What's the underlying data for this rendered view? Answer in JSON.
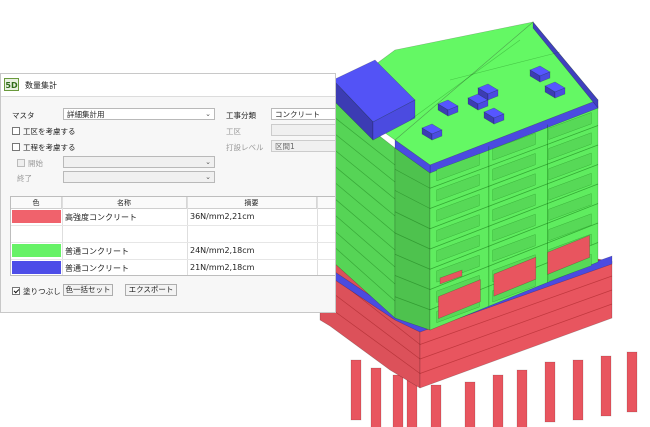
{
  "window": {
    "title": "数量集計",
    "logo": "5D"
  },
  "form": {
    "master_label": "マスタ",
    "master_value": "詳細集計用",
    "work_label": "工事分類",
    "work_value": "コンクリート",
    "consider_zone_label": "工区を考慮する",
    "zone_label": "工区",
    "zone_value": "",
    "consider_process_label": "工程を考慮する",
    "pour_level_label": "打設レベル",
    "pour_level_value": "区間1",
    "start_label": "開始",
    "start_value": "",
    "end_label": "終了",
    "end_value": ""
  },
  "table": {
    "headers": [
      "色",
      "名称",
      "摘要"
    ],
    "rows": [
      {
        "color": "#f0626c",
        "name": "高強度コンクリート",
        "spec": "36N/mm2,21cm"
      },
      {
        "color": "#ffffff",
        "name": "",
        "spec": ""
      },
      {
        "color": "#66f266",
        "name": "普通コンクリート",
        "spec": "24N/mm2,18cm"
      },
      {
        "color": "#4d4de8",
        "name": "普通コンクリート",
        "spec": "21N/mm2,18cm"
      }
    ]
  },
  "bottom": {
    "fill_label": "塗りつぶし",
    "fill_checked": true,
    "batch_color_button": "色一括セット",
    "export_button": "エクスポート"
  },
  "icons": {
    "chevron": "chevron-down-icon",
    "check": "check-icon"
  },
  "colors": {
    "high_strength_red": "#e8555f",
    "standard_green": "#5fec5f",
    "standard_blue": "#4b4be0"
  }
}
